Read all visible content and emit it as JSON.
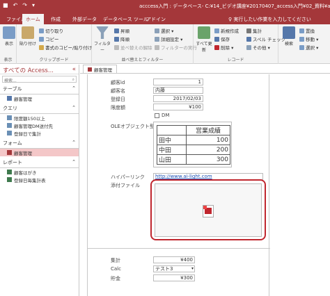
{
  "titlebar": {
    "title": "acccess入門 : データベース- C:¥14_ビデオ講座¥20170407_access入門¥02_資料¥accc"
  },
  "tabs": [
    {
      "label": "ファイル"
    },
    {
      "label": "ホーム"
    },
    {
      "label": "作成"
    },
    {
      "label": "外部データ"
    },
    {
      "label": "データベース ツール"
    },
    {
      "label": "アドイン"
    }
  ],
  "tellme": "♀ 実行したい作業を入力してください",
  "ribbon": {
    "groups": {
      "view": "表示",
      "clipboard": "クリップボード",
      "sortfilter": "並べ替えとフィルター",
      "records": "レコード"
    },
    "view_btn": "表示",
    "paste_btn": "貼り付け",
    "cut": "切り取り",
    "copy": "コピー",
    "format_painter": "書式のコピー/貼り付け",
    "filter_btn": "フィルター",
    "asc": "昇順",
    "desc": "降順",
    "clear_sort": "並べ替えの解除",
    "selection": "選択 ▾",
    "advanced": "詳細設定 ▾",
    "toggle_filter": "フィルターの実行",
    "refresh_btn": "すべて更新",
    "new": "新規作成",
    "save": "保存",
    "delete": "削除 ▾",
    "totals": "集計",
    "spelling": "スペル チェック",
    "more": "その他 ▾",
    "find_btn": "検索",
    "replace": "置換",
    "goto": "移動 ▾",
    "select": "選択 ▾"
  },
  "nav": {
    "title": "すべての Access...",
    "search_placeholder": "検索...",
    "sections": [
      {
        "label": "テーブル",
        "items": [
          "顧客管理"
        ]
      },
      {
        "label": "クエリ",
        "items": [
          "限度額150以上",
          "顧客管理DM送付先",
          "登録日で集計"
        ]
      },
      {
        "label": "フォーム",
        "items": [
          "顧客管理"
        ]
      },
      {
        "label": "レポート",
        "items": [
          "顧客はがき",
          "登録日毎集計表"
        ]
      }
    ]
  },
  "doc_tab": "顧客管理",
  "form": {
    "labels": {
      "id": "顧客id",
      "name": "顧客名",
      "date": "登録日",
      "limit": "限度額",
      "dm": "DM",
      "ole": "OLEオブジェクト型",
      "link": "ハイパーリンク",
      "attach": "添付ファイル",
      "total": "集計",
      "calc": "Calc",
      "tax": "貯金"
    },
    "values": {
      "id": "1",
      "name": "内藤",
      "date": "2017/02/03",
      "limit": "¥100",
      "link": "http://www.ai-light.com",
      "total": "¥400",
      "calc": "テスト3",
      "tax": "¥300"
    },
    "ole_table": {
      "header": [
        "",
        "営業成績"
      ],
      "rows": [
        [
          "田中",
          "100"
        ],
        [
          "中田",
          "200"
        ],
        [
          "山田",
          "300"
        ]
      ]
    }
  },
  "colors": {
    "accent": "#a4373a",
    "highlight": "#c0262e",
    "selected_nav": "#f4c7c8"
  }
}
